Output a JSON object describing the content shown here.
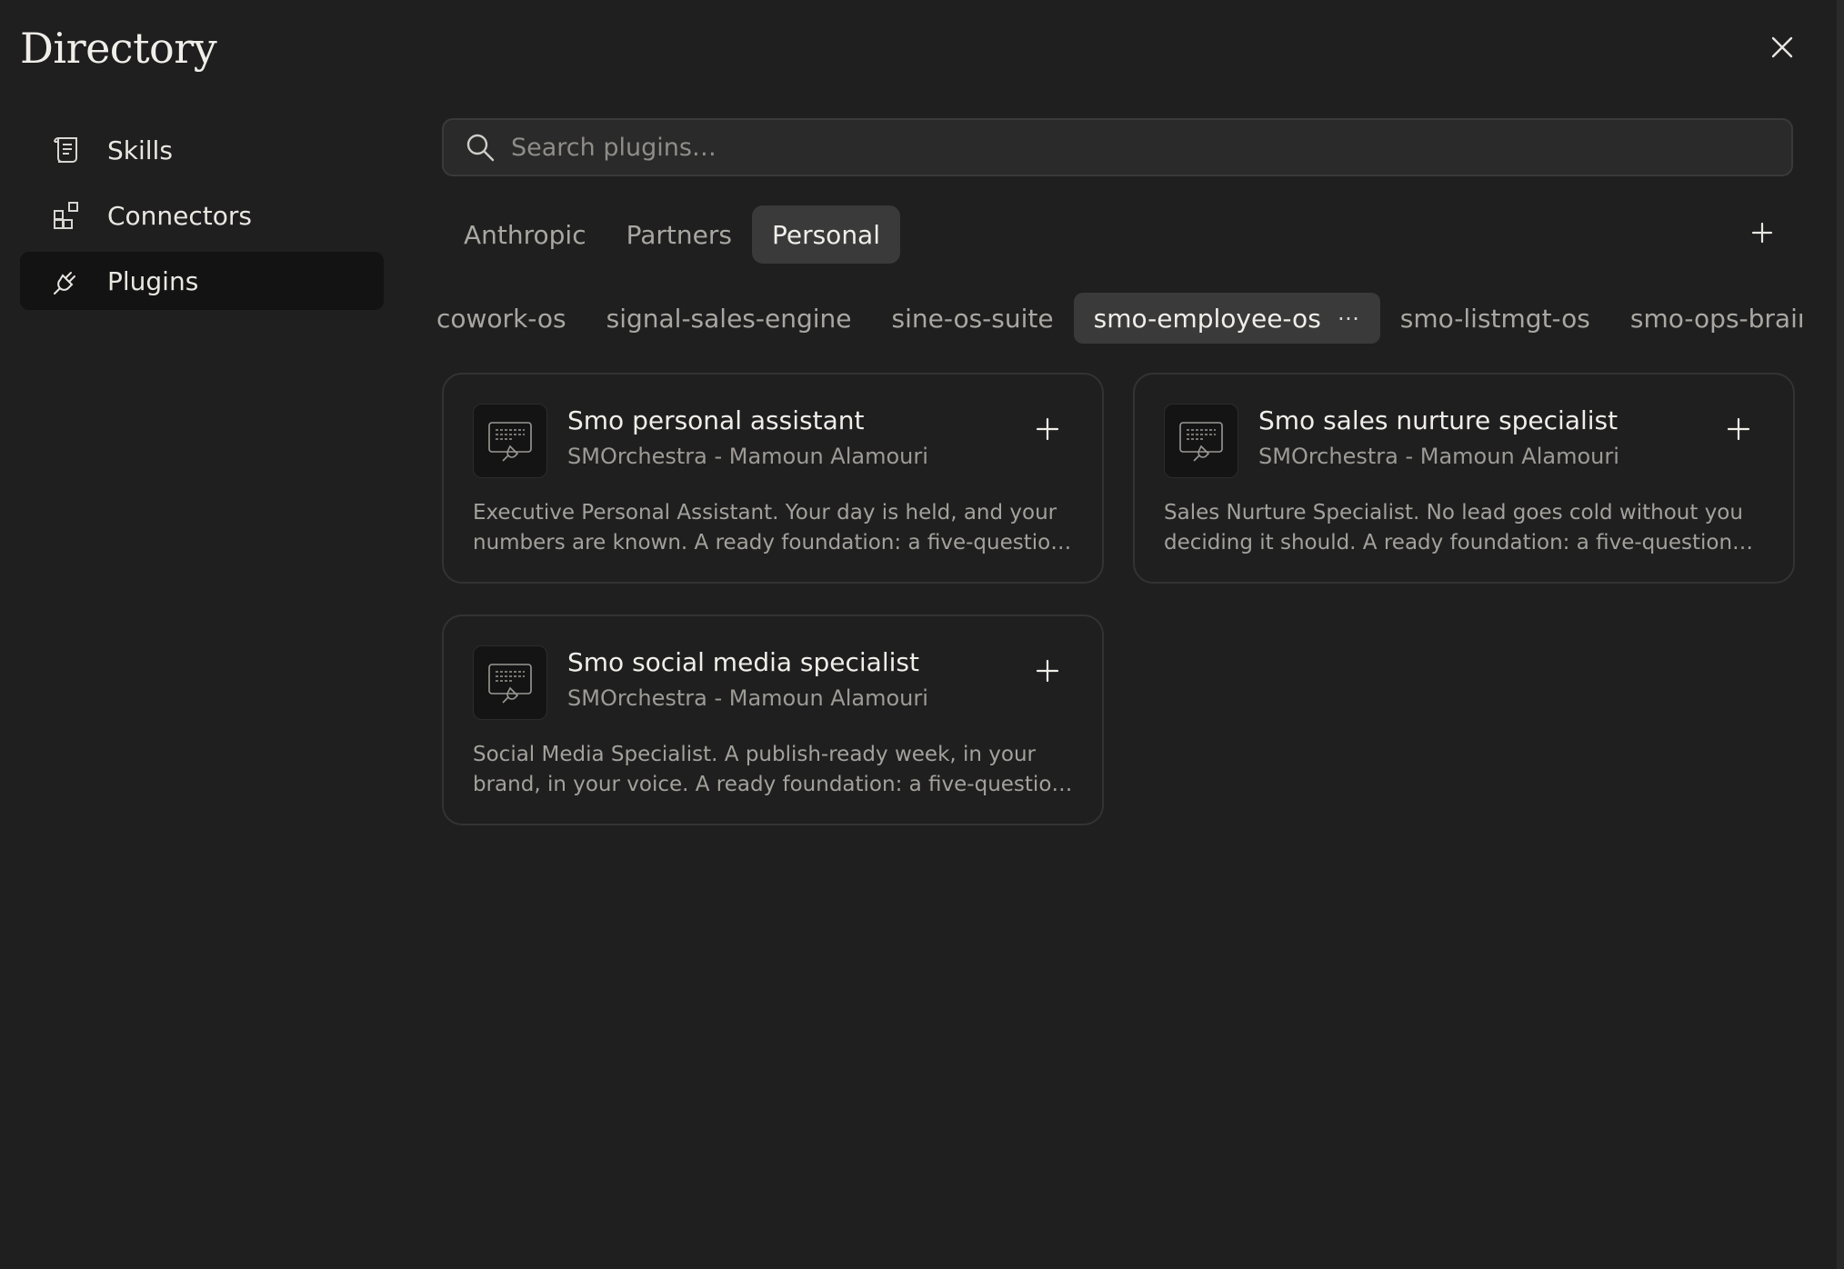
{
  "header": {
    "title": "Directory",
    "close_icon": "close-icon"
  },
  "sidebar": {
    "items": [
      {
        "label": "Skills",
        "icon": "scroll-icon",
        "active": false
      },
      {
        "label": "Connectors",
        "icon": "connectors-icon",
        "active": false
      },
      {
        "label": "Plugins",
        "icon": "plug-icon",
        "active": true
      }
    ]
  },
  "search": {
    "placeholder": "Search plugins…",
    "value": ""
  },
  "tabs": {
    "items": [
      {
        "label": "Anthropic",
        "active": false
      },
      {
        "label": "Partners",
        "active": false
      },
      {
        "label": "Personal",
        "active": true
      }
    ],
    "add_icon": "plus-icon"
  },
  "subtabs": {
    "items": [
      {
        "label": "cowork-os",
        "active": false
      },
      {
        "label": "signal-sales-engine",
        "active": false
      },
      {
        "label": "sine-os-suite",
        "active": false
      },
      {
        "label": "smo-employee-os",
        "active": true,
        "more": "⋯"
      },
      {
        "label": "smo-listmgt-os",
        "active": false
      },
      {
        "label": "smo-ops-brain",
        "active": false
      }
    ]
  },
  "cards": [
    {
      "name": "Smo personal assistant",
      "author": "SMOrchestra - Mamoun Alamouri",
      "description": "Executive Personal Assistant. Your day is held, and your numbers are known. A ready foundation: a five-question onboarding and everything ready to go."
    },
    {
      "name": "Smo sales nurture specialist",
      "author": "SMOrchestra - Mamoun Alamouri",
      "description": "Sales Nurture Specialist. No lead goes cold without you deciding it should. A ready foundation: a five-question onboarding and everything ready to go."
    },
    {
      "name": "Smo social media specialist",
      "author": "SMOrchestra - Mamoun Alamouri",
      "description": "Social Media Specialist. A publish-ready week, in your brand, in your voice. A ready foundation: a five-question onboarding and everything ready to go."
    }
  ],
  "colors": {
    "background": "#1f1f1f",
    "active_item": "#131313",
    "active_tab": "#3a3a3a",
    "border": "#333333"
  }
}
